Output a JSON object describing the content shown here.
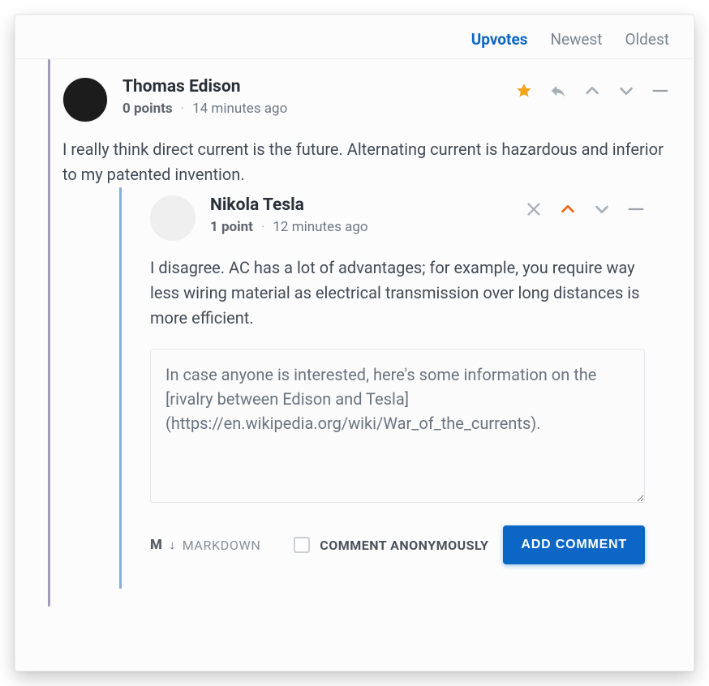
{
  "sort": {
    "tabs": [
      "Upvotes",
      "Newest",
      "Oldest"
    ],
    "active": 0
  },
  "comments": [
    {
      "author": "Thomas Edison",
      "points_label": "0 points",
      "time": "14 minutes ago",
      "body": "I really think direct current is the future. Alternating current is hazardous and inferior to my patented invention.",
      "actions": {
        "starred": true,
        "upvoted": false
      }
    },
    {
      "author": "Nikola Tesla",
      "points_label": "1 point",
      "time": "12 minutes ago",
      "body": "I disagree. AC has a lot of advantages; for example, you require way less wiring material as electrical transmission over long distances is more efficient.",
      "actions": {
        "upvoted": true
      }
    }
  ],
  "editor": {
    "value": "In case anyone is interested, here's some information on the [rivalry between Edison and Tesla](https://en.wikipedia.org/wiki/War_of_the_currents)."
  },
  "footer": {
    "md_glyph": "M",
    "md_label": "MARKDOWN",
    "anon_label": "COMMENT ANONYMOUSLY",
    "submit_label": "ADD COMMENT"
  }
}
